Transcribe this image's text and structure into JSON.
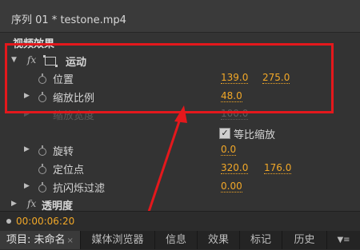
{
  "sequence_title": "序列 01 * testone.mp4",
  "section_label": "视频效果",
  "motion": {
    "fx": "fx",
    "label": "运动"
  },
  "properties": {
    "position": {
      "label": "位置",
      "x": "139.0",
      "y": "275.0"
    },
    "scale": {
      "label": "缩放比例",
      "value": "48.0"
    },
    "scale_width": {
      "label": "缩放宽度",
      "value": "100.0"
    },
    "uniform_scale": {
      "label": "等比缩放",
      "checked": true
    },
    "rotation": {
      "label": "旋转",
      "value": "0.0"
    },
    "anchor": {
      "label": "定位点",
      "x": "320.0",
      "y": "176.0"
    },
    "antiflicker": {
      "label": "抗闪烁过滤",
      "value": "0.00"
    }
  },
  "opacity": {
    "fx": "fx",
    "label": "透明度"
  },
  "timecode": "00:00:06:20",
  "tabs": [
    {
      "label": "项目: 未命名",
      "close": "×"
    },
    {
      "label": "媒体浏览器"
    },
    {
      "label": "信息"
    },
    {
      "label": "效果"
    },
    {
      "label": "标记"
    },
    {
      "label": "历史"
    },
    {
      "label": "▼≡"
    }
  ],
  "colors": {
    "highlight": "#e4181c",
    "value": "#f2a828"
  }
}
